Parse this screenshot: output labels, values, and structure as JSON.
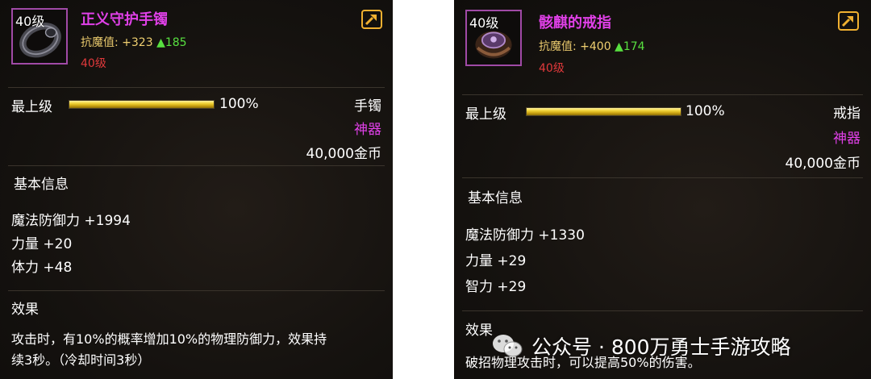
{
  "left": {
    "level_tag": "40级",
    "name": "正义守护手镯",
    "stat_label": "抗魔值:",
    "stat_value": "+323",
    "stat_up": "▲185",
    "req_level": "40级",
    "grade_label": "最上级",
    "grade_percent_value": 100,
    "grade_percent": "100%",
    "type": "手镯",
    "rarity": "神器",
    "price": "40,000金币",
    "section_basic": "基本信息",
    "attributes": [
      "魔法防御力 +1994",
      "力量 +20",
      "体力 +48"
    ],
    "section_effect": "效果",
    "effect_lines": [
      "攻击时，有10%的概率增加10%的物理防御力，效果持",
      "续3秒。（冷却时间3秒）"
    ]
  },
  "right": {
    "level_tag": "40级",
    "name": "骸麒的戒指",
    "stat_label": "抗魔值:",
    "stat_value": "+400",
    "stat_up": "▲174",
    "req_level": "40级",
    "grade_label": "最上级",
    "grade_percent_value": 100,
    "grade_percent": "100%",
    "type": "戒指",
    "rarity": "神器",
    "price": "40,000金币",
    "section_basic": "基本信息",
    "attributes": [
      "魔法防御力 +1330",
      "力量 +29",
      "智力 +29"
    ],
    "section_effect": "效果",
    "effect_lines": [
      "破招物理攻击时，可以提高50%的伤害。"
    ]
  },
  "watermark": {
    "text": "公众号 · 800万勇士手游攻略",
    "icon": "wechat-icon"
  },
  "icons": {
    "share": "share-icon",
    "bracelet": "bracelet-icon",
    "ring": "ring-icon"
  },
  "colors": {
    "epic_name": "#e040e8",
    "required_level": "#e0393b",
    "stat_up": "#58e040",
    "grade_bar": "#f2d43a",
    "share_icon": "#f0b030"
  }
}
